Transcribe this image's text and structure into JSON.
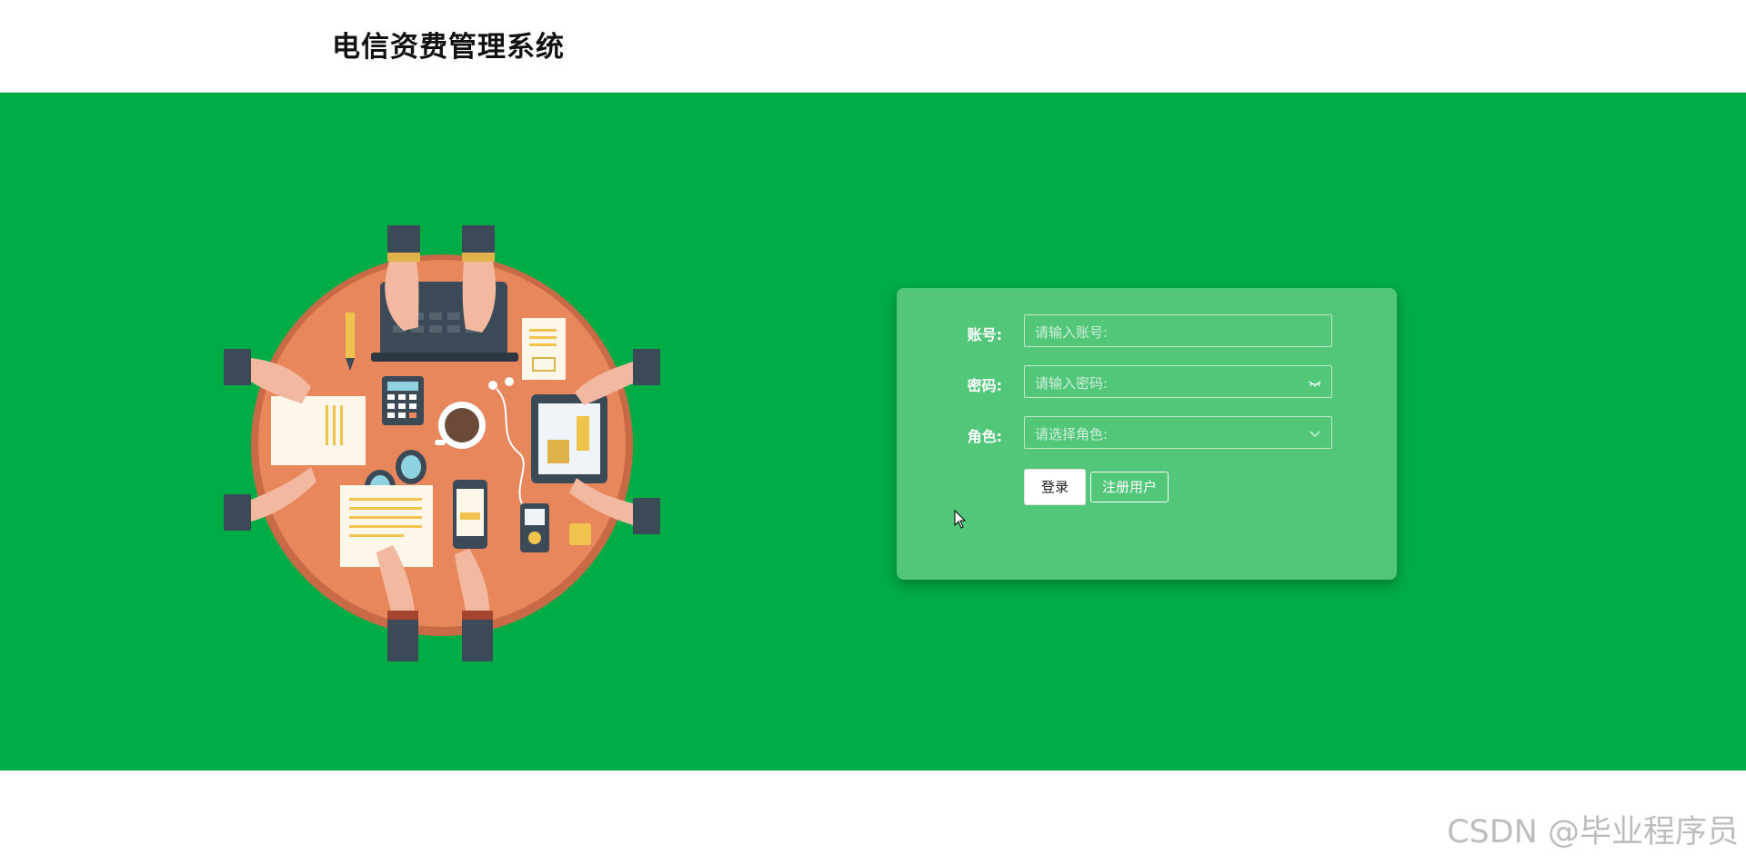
{
  "header": {
    "title": "电信资费管理系统"
  },
  "login": {
    "account_label": "账号:",
    "account_placeholder": "请输入账号:",
    "password_label": "密码:",
    "password_placeholder": "请输入密码:",
    "role_label": "角色:",
    "role_placeholder": "请选择角色:",
    "login_button": "登录",
    "register_button": "注册用户"
  },
  "icons": {
    "password_toggle": "eye-closed-icon",
    "role_dropdown": "chevron-down-icon"
  },
  "colors": {
    "hero_background": "#00ac45",
    "card_background": "#52c77a",
    "table_orange": "#e8875c"
  },
  "watermark": "CSDN @毕业程序员"
}
